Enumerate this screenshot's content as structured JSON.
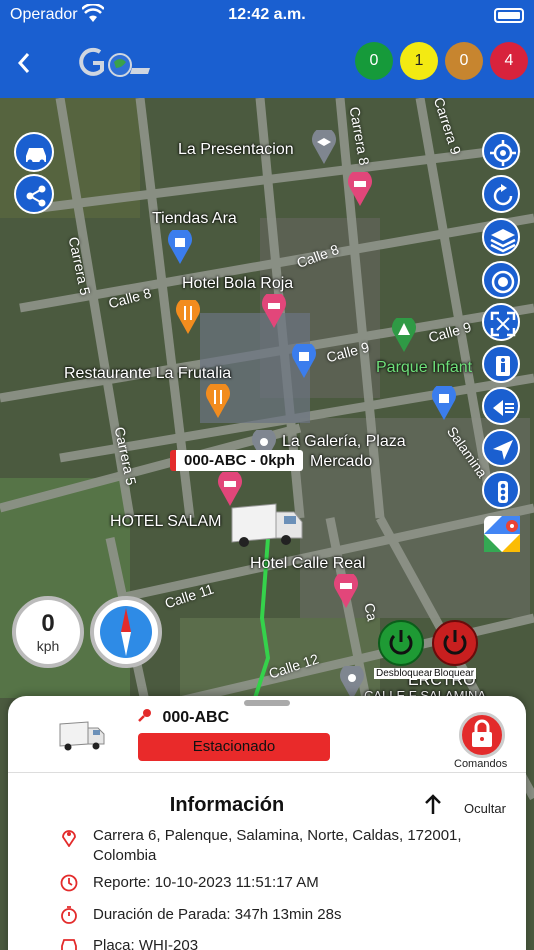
{
  "status_bar": {
    "carrier": "Operador",
    "time": "12:42 a.m."
  },
  "header": {
    "counters": [
      "0",
      "1",
      "0",
      "4"
    ],
    "counter_colors": [
      "#169a3a",
      "#f3ea12",
      "#c7852f",
      "#d8233c"
    ]
  },
  "map": {
    "places": {
      "la_presentacion": "La Presentacion",
      "tiendas_ara": "Tiendas Ara",
      "hotel_bola_roja": "Hotel Bola Roja",
      "restaurante": "Restaurante La Frutalia",
      "parque": "Parque Infant",
      "la_galeria": "La Galería, Plaza",
      "mercado": "Mercado",
      "hotel_salam": "HOTEL SALAM",
      "hotel_calle_real": "Hotel Calle Real",
      "centro": "ERCTRO",
      "calle_f_salamina": "CALLE F SALAMINA"
    },
    "streets": {
      "carrera8": "Carrera 8",
      "carrera9": "Carrera 9",
      "carrera5_top": "Carrera 5",
      "calle8_a": "Calle 8",
      "calle8_b": "Calle 8",
      "calle9_a": "Calle 9",
      "calle9_b": "Calle 9",
      "carrera5_mid": "Carrera 5",
      "salamina": "Salamina",
      "calle11": "Calle 11",
      "calle12": "Calle 12",
      "carrera_short": "Ca"
    },
    "vehicle_tag": "000-ABC - 0kph",
    "speed": {
      "value": "0",
      "unit": "kph"
    },
    "unlock_label": "Desbloquear",
    "lock_label": "Bloquear"
  },
  "sheet": {
    "plate": "000-ABC",
    "status": "Estacionado",
    "commands_label": "Comandos",
    "info_title": "Información",
    "hide_label": "Ocultar",
    "address": "Carrera 6, Palenque, Salamina, Norte, Caldas, 172001, Colombia",
    "report": "Reporte: 10-10-2023 11:51:17 AM",
    "stop_duration": "Duración de Parada: 347h 13min 28s",
    "plate_row": "Placa: WHI-203"
  }
}
